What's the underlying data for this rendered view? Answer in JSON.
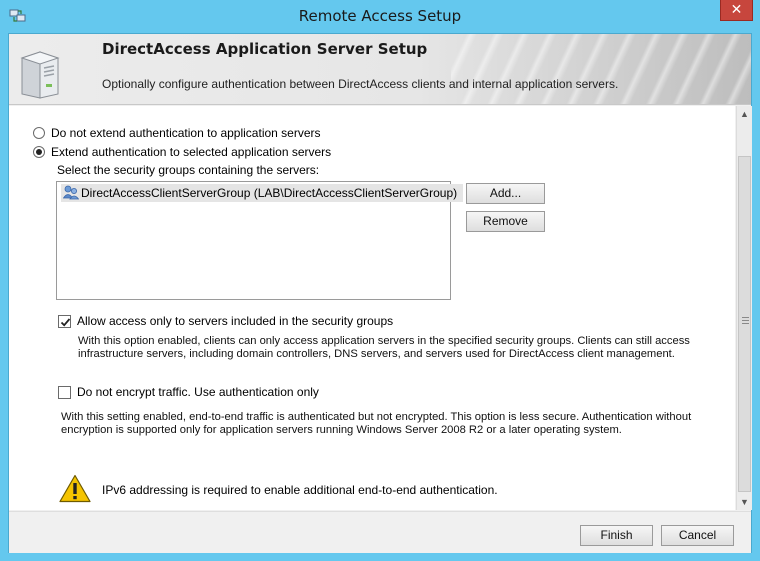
{
  "window": {
    "title": "Remote Access Setup",
    "close_label": "✕"
  },
  "banner": {
    "title": "DirectAccess Application Server Setup",
    "subtitle": "Optionally configure authentication between DirectAccess clients and internal application servers."
  },
  "options": {
    "no_extend_label": "Do not extend authentication to application servers",
    "extend_label": "Extend authentication to selected application servers",
    "selected": "extend"
  },
  "groups": {
    "label": "Select the security groups containing the servers:",
    "items": [
      {
        "label": "DirectAccessClientServerGroup (LAB\\DirectAccessClientServerGroup)"
      }
    ],
    "add_label": "Add...",
    "remove_label": "Remove"
  },
  "allow_access": {
    "label": "Allow access only to servers included in the security groups",
    "checked": true,
    "desc_line1": "With this option enabled, clients can only access application servers in the specified security groups. Clients can still access",
    "desc_line2": "infrastructure servers, including domain controllers, DNS servers, and servers used for DirectAccess client management."
  },
  "no_encrypt": {
    "label": "Do not encrypt traffic. Use authentication only",
    "checked": false,
    "desc_line1": "With this setting enabled, end-to-end traffic is authenticated but not encrypted. This option is less secure. Authentication without",
    "desc_line2": "encryption is supported only for application servers running Windows Server 2008 R2 or a later operating system."
  },
  "warning": {
    "text": "IPv6 addressing is required to enable additional end-to-end authentication."
  },
  "footer": {
    "finish_label": "Finish",
    "cancel_label": "Cancel"
  },
  "colors": {
    "title_bar": "#64c8ee",
    "close_button": "#c7463d",
    "warning": "#f5c400"
  }
}
